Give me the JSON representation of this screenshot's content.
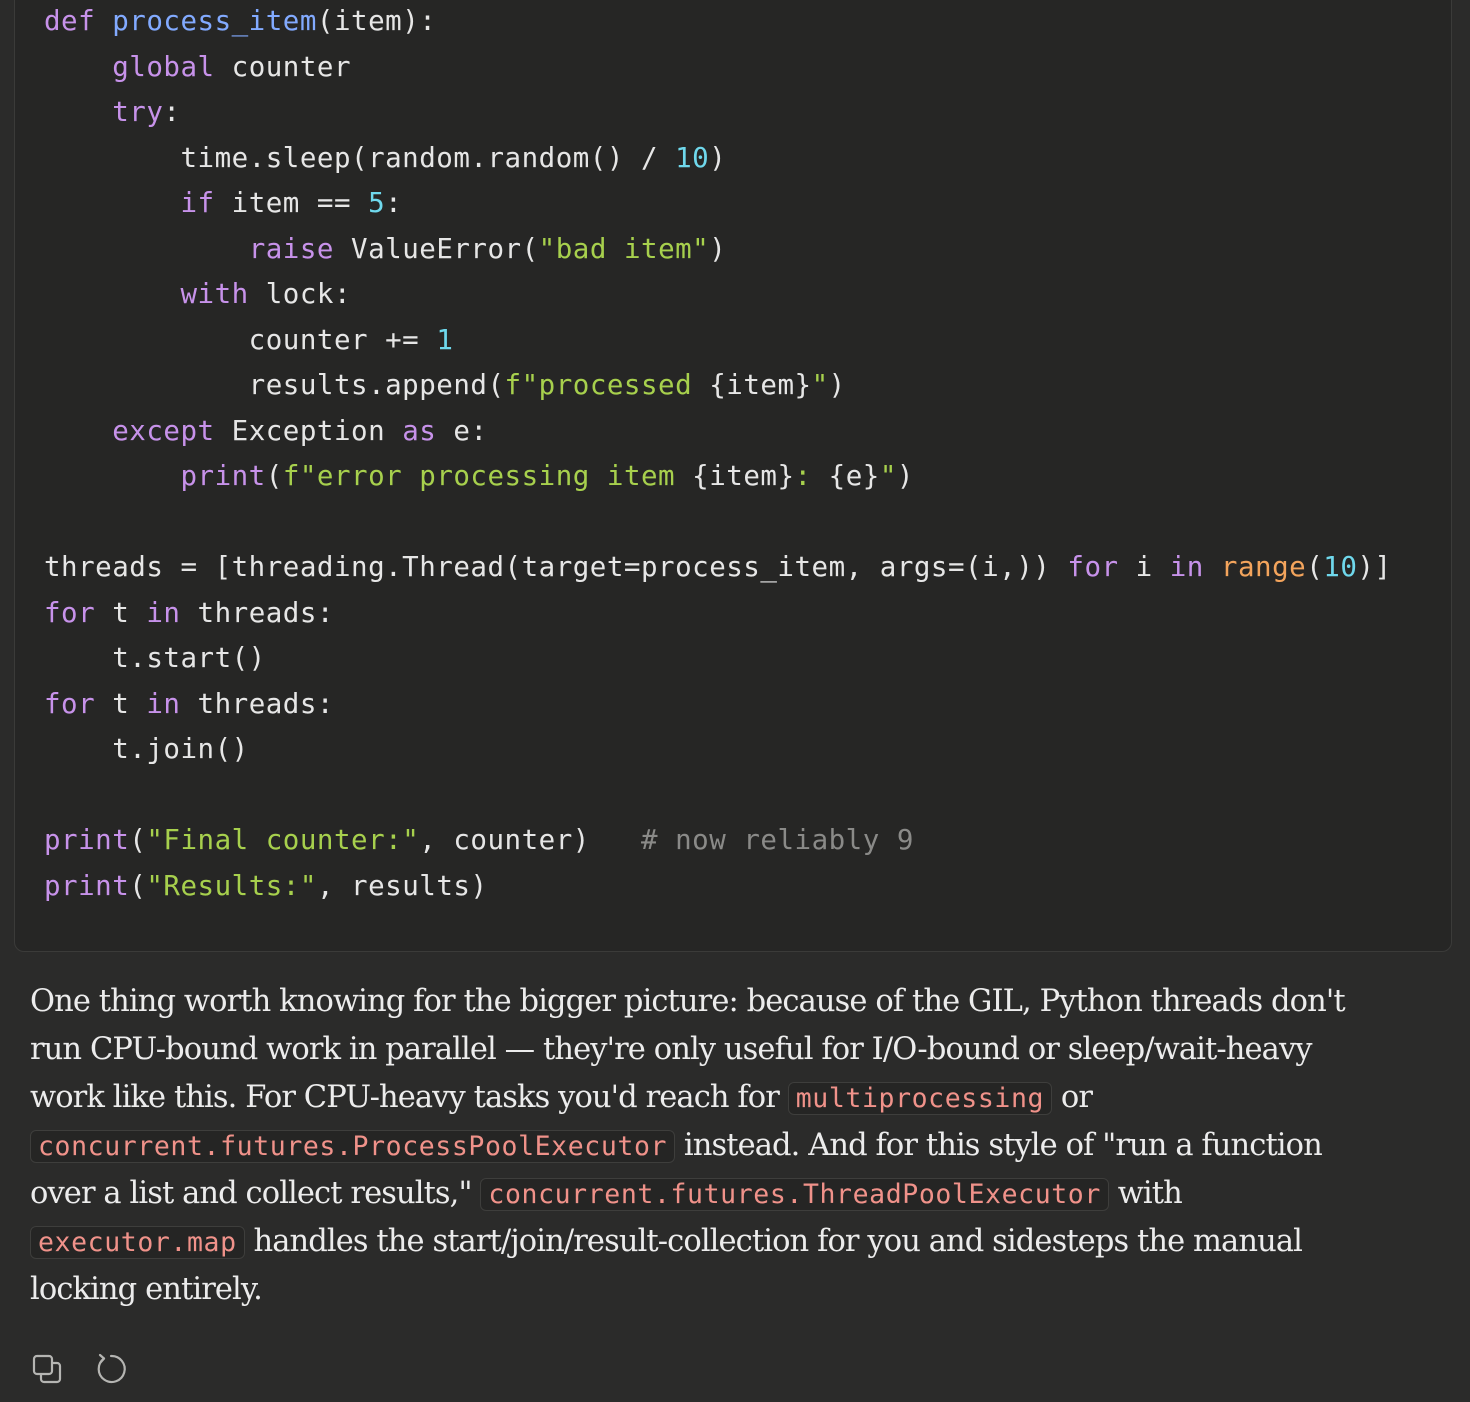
{
  "code_block": {
    "lines": [
      [
        {
          "t": "def",
          "c": "kw"
        },
        {
          "t": " "
        },
        {
          "t": "process_item",
          "c": "fn"
        },
        {
          "t": "(item):"
        }
      ],
      [
        {
          "t": "    "
        },
        {
          "t": "global",
          "c": "kw"
        },
        {
          "t": " counter"
        }
      ],
      [
        {
          "t": "    "
        },
        {
          "t": "try",
          "c": "kw"
        },
        {
          "t": ":"
        }
      ],
      [
        {
          "t": "        time.sleep(random.random() / "
        },
        {
          "t": "10",
          "c": "num"
        },
        {
          "t": ")"
        }
      ],
      [
        {
          "t": "        "
        },
        {
          "t": "if",
          "c": "kw"
        },
        {
          "t": " item == "
        },
        {
          "t": "5",
          "c": "num"
        },
        {
          "t": ":"
        }
      ],
      [
        {
          "t": "            "
        },
        {
          "t": "raise",
          "c": "kw"
        },
        {
          "t": " ValueError("
        },
        {
          "t": "\"bad item\"",
          "c": "str"
        },
        {
          "t": ")"
        }
      ],
      [
        {
          "t": "        "
        },
        {
          "t": "with",
          "c": "kw"
        },
        {
          "t": " lock:"
        }
      ],
      [
        {
          "t": "            counter += "
        },
        {
          "t": "1",
          "c": "num"
        }
      ],
      [
        {
          "t": "            results.append("
        },
        {
          "t": "f\"processed ",
          "c": "str"
        },
        {
          "t": "{item}"
        },
        {
          "t": "\"",
          "c": "str"
        },
        {
          "t": ")"
        }
      ],
      [
        {
          "t": "    "
        },
        {
          "t": "except",
          "c": "kw"
        },
        {
          "t": " Exception "
        },
        {
          "t": "as",
          "c": "kw"
        },
        {
          "t": " e:"
        }
      ],
      [
        {
          "t": "        "
        },
        {
          "t": "print",
          "c": "kw"
        },
        {
          "t": "("
        },
        {
          "t": "f\"error processing item ",
          "c": "str"
        },
        {
          "t": "{item}"
        },
        {
          "t": ": ",
          "c": "str"
        },
        {
          "t": "{e}"
        },
        {
          "t": "\"",
          "c": "str"
        },
        {
          "t": ")"
        }
      ],
      [],
      [
        {
          "t": "threads = [threading.Thread(target=process_item, args=(i,)) "
        },
        {
          "t": "for",
          "c": "kw"
        },
        {
          "t": " i "
        },
        {
          "t": "in",
          "c": "kw"
        },
        {
          "t": " "
        },
        {
          "t": "range",
          "c": "bi"
        },
        {
          "t": "("
        },
        {
          "t": "10",
          "c": "num"
        },
        {
          "t": ")]"
        }
      ],
      [
        {
          "t": "for",
          "c": "kw"
        },
        {
          "t": " t "
        },
        {
          "t": "in",
          "c": "kw"
        },
        {
          "t": " threads:"
        }
      ],
      [
        {
          "t": "    t.start()"
        }
      ],
      [
        {
          "t": "for",
          "c": "kw"
        },
        {
          "t": " t "
        },
        {
          "t": "in",
          "c": "kw"
        },
        {
          "t": " threads:"
        }
      ],
      [
        {
          "t": "    t.join()"
        }
      ],
      [],
      [
        {
          "t": "print",
          "c": "kw"
        },
        {
          "t": "("
        },
        {
          "t": "\"Final counter:\"",
          "c": "str"
        },
        {
          "t": ", counter)   "
        },
        {
          "t": "# now reliably 9",
          "c": "cm"
        }
      ],
      [
        {
          "t": "print",
          "c": "kw"
        },
        {
          "t": "("
        },
        {
          "t": "\"Results:\"",
          "c": "str"
        },
        {
          "t": ", results)"
        }
      ]
    ]
  },
  "message": {
    "lines": [
      [
        {
          "t": "One thing worth knowing for the bigger picture: because of the GIL, Python threads don't"
        }
      ],
      [
        {
          "t": "run CPU-bound work in parallel — they're only useful for I/O-bound or sleep/wait-heavy"
        }
      ],
      [
        {
          "t": "work like this. For CPU-heavy tasks you'd reach for "
        },
        {
          "t": "multiprocessing",
          "code": true
        },
        {
          "t": " or"
        }
      ],
      [
        {
          "t": "concurrent.futures.ProcessPoolExecutor",
          "code": true
        },
        {
          "t": " instead. And for this style of \"run a function"
        }
      ],
      [
        {
          "t": "over a list and collect results,\" "
        },
        {
          "t": "concurrent.futures.ThreadPoolExecutor",
          "code": true
        },
        {
          "t": " with"
        }
      ],
      [
        {
          "t": "executor.map",
          "code": true
        },
        {
          "t": " handles the start/join/result-collection for you and sidesteps the manual"
        }
      ],
      [
        {
          "t": "locking entirely."
        }
      ]
    ]
  },
  "actions": {
    "copy_icon": "copy-icon",
    "retry_icon": "retry-icon"
  },
  "colors": {
    "background": "#2b2b2a",
    "code_background": "#262625",
    "keyword": "#c792ea",
    "function": "#82aaff",
    "number": "#6fd8ec",
    "string": "#a7d04d",
    "builtin": "#f3a45c",
    "comment": "#8a8a88",
    "inline_code": "#f0928a"
  }
}
